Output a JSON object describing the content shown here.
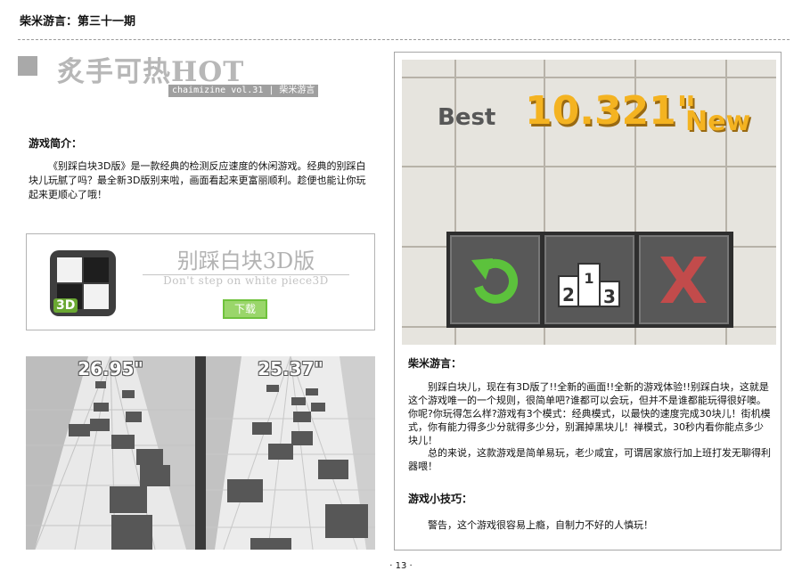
{
  "header": {
    "issue_title": "柴米游言：第三十一期",
    "section_title": "炙手可热HOT",
    "sub_tag": "chaimizine vol.31 | 柴米游言"
  },
  "intro": {
    "heading": "游戏简介：",
    "text": "《别踩白块3D版》是一款经典的检测反应速度的休闲游戏。经典的别踩白块儿玩腻了吗？最全新3D版别来啦，画面看起来更富丽顺利。趁便也能让你玩起来更顺心了哦！"
  },
  "download_box": {
    "icon_badge": "3D",
    "title": "别踩白块3D版",
    "subtitle": "Don't step on white piece3D",
    "button_label": "下载"
  },
  "screenshots": {
    "left_time": "26.95\"",
    "right_time": "25.37\""
  },
  "game_image": {
    "best_label": "Best",
    "best_score": "10.321\"",
    "new_label": "New"
  },
  "review": {
    "heading": "柴米游言：",
    "paragraph1": "别踩白块儿，现在有3D版了!!全新的画面!!全新的游戏体验!!别踩白块，这就是这个游戏唯一的一个规则，很简单吧?谁都可以会玩，但并不是谁都能玩得很好噢。你呢?你玩得怎么样?游戏有3个模式：经典模式，以最快的速度完成30块儿！街机模式，你有能力得多少分就得多少分，别漏掉黑块儿！禅模式，30秒内看你能点多少块儿！",
    "paragraph2": "总的来说，这款游戏是简单易玩，老少咸宜，可谓居家旅行加上班打发无聊得利器喂！"
  },
  "tips": {
    "heading": "游戏小技巧：",
    "text": "警告，这个游戏很容易上瘾，自制力不好的人慎玩！"
  },
  "page_number": "· 13 ·"
}
